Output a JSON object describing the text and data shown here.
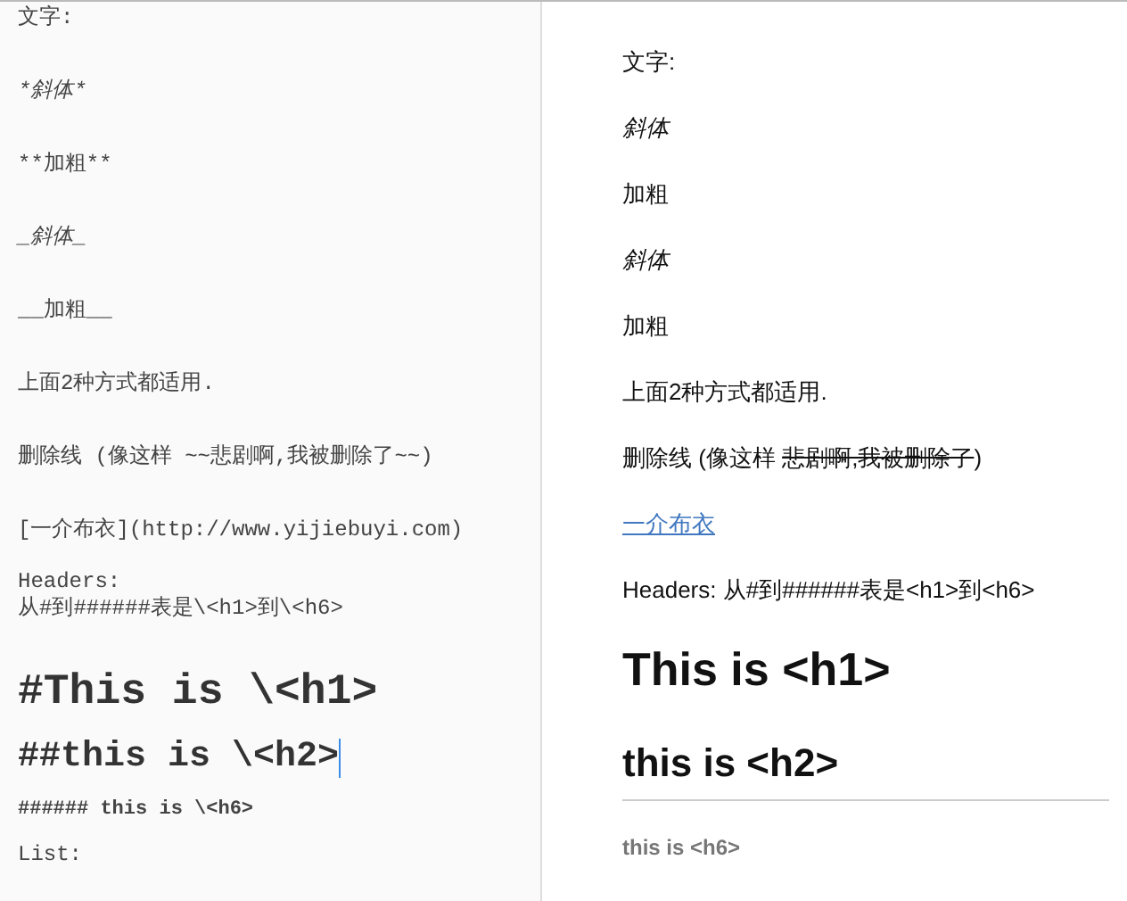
{
  "editor": {
    "lines": [
      {
        "kind": "text",
        "text": "文字:",
        "cursor": false
      },
      {
        "kind": "italic",
        "text": "*斜体*",
        "cursor": false
      },
      {
        "kind": "text",
        "text": "**加粗**",
        "cursor": false
      },
      {
        "kind": "italic",
        "text": "_斜体_",
        "cursor": false
      },
      {
        "kind": "text",
        "text": "__加粗__",
        "cursor": false
      },
      {
        "kind": "text",
        "text": "上面2种方式都适用.",
        "cursor": false
      },
      {
        "kind": "text",
        "text": "删除线 (像这样 ~~悲剧啊,我被删除了~~)",
        "cursor": false
      },
      {
        "kind": "text",
        "text": "[一介布衣](http://www.yijiebuyi.com)",
        "cursor": false
      },
      {
        "kind": "text",
        "text": "Headers:\n从#到######表是\\<h1>到\\<h6>",
        "cursor": false
      },
      {
        "kind": "h1",
        "text": "#This is \\<h1>",
        "cursor": false
      },
      {
        "kind": "h2",
        "text": "##this is \\<h2>",
        "cursor": true
      },
      {
        "kind": "h6",
        "text": "###### this is \\<h6>",
        "cursor": false
      },
      {
        "kind": "text",
        "text": "List:",
        "cursor": false
      }
    ]
  },
  "preview": {
    "blocks": [
      {
        "kind": "p",
        "text": "文字:"
      },
      {
        "kind": "em",
        "text": "斜体"
      },
      {
        "kind": "p",
        "text": "加粗"
      },
      {
        "kind": "em",
        "text": "斜体"
      },
      {
        "kind": "p",
        "text": "加粗"
      },
      {
        "kind": "p",
        "text": "上面2种方式都适用."
      },
      {
        "kind": "del",
        "before": "删除线 (像这样 ",
        "struck": "悲剧啊,我被删除了",
        "after": ")"
      },
      {
        "kind": "link",
        "text": "一介布衣"
      },
      {
        "kind": "p",
        "text": "Headers: 从#到######表是<h1>到<h6>"
      },
      {
        "kind": "h1",
        "text": "This is <h1>"
      },
      {
        "kind": "h2",
        "text": "this is <h2>"
      },
      {
        "kind": "h6",
        "text": "this is <h6>"
      }
    ]
  }
}
